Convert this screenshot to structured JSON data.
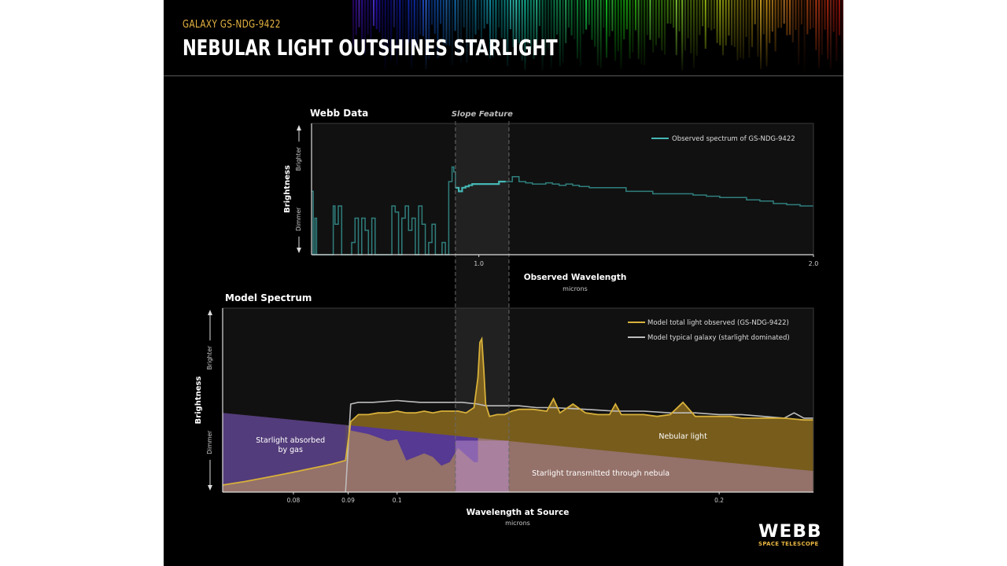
{
  "header": {
    "subtitle": "GALAXY GS-NDG-9422",
    "title": "NEBULAR LIGHT OUTSHINES STARLIGHT"
  },
  "logo": {
    "main": "WEBB",
    "sub": "SPACE TELESCOPE"
  },
  "colors": {
    "observed": "#45b7b4",
    "model_total": "#d8b13a",
    "typical_galaxy": "#bdbdbd",
    "nebular_fill": "#8a6a1e",
    "absorbed_fill": "#4a2f9a",
    "transmitted_fill": "#b98bc8",
    "panel_bg": "#111111"
  },
  "chart_data": [
    {
      "type": "line",
      "title": "Webb Data",
      "highlight_label": "Slope Feature",
      "xlabel": "Observed Wavelength",
      "xunit": "microns",
      "ylabel": "Brightness",
      "y_up_label": "Brighter",
      "y_down_label": "Dimmer",
      "xlim": [
        0.5,
        2.0
      ],
      "xticks": [
        {
          "value": 1.0,
          "label": "1.0"
        },
        {
          "value": 2.0,
          "label": "2.0"
        }
      ],
      "slope_feature_x": [
        0.93,
        1.09
      ],
      "legend_position": "top-right",
      "series": [
        {
          "name": "Observed spectrum of GS-NDG-9422",
          "step": true,
          "x": [
            0.5,
            0.505,
            0.51,
            0.515,
            0.52,
            0.53,
            0.54,
            0.55,
            0.56,
            0.565,
            0.57,
            0.58,
            0.59,
            0.6,
            0.61,
            0.62,
            0.63,
            0.64,
            0.65,
            0.66,
            0.67,
            0.68,
            0.69,
            0.7,
            0.71,
            0.72,
            0.73,
            0.74,
            0.75,
            0.76,
            0.77,
            0.78,
            0.79,
            0.8,
            0.81,
            0.82,
            0.83,
            0.84,
            0.85,
            0.86,
            0.87,
            0.88,
            0.89,
            0.9,
            0.91,
            0.92,
            0.925,
            0.93,
            0.94,
            0.95,
            0.96,
            0.97,
            0.98,
            0.99,
            1.0,
            1.02,
            1.04,
            1.06,
            1.08,
            1.1,
            1.12,
            1.14,
            1.16,
            1.18,
            1.2,
            1.22,
            1.24,
            1.26,
            1.28,
            1.3,
            1.33,
            1.36,
            1.4,
            1.44,
            1.48,
            1.52,
            1.56,
            1.6,
            1.64,
            1.68,
            1.72,
            1.76,
            1.8,
            1.84,
            1.88,
            1.92,
            1.96,
            2.0
          ],
          "y": [
            0.52,
            0.0,
            0.3,
            0.0,
            0.0,
            0.0,
            0.0,
            0.0,
            0.0,
            0.4,
            0.25,
            0.4,
            0.0,
            0.0,
            0.0,
            0.1,
            0.3,
            0.0,
            0.3,
            0.2,
            0.0,
            0.3,
            0.0,
            0.0,
            0.0,
            0.0,
            0.0,
            0.4,
            0.35,
            0.0,
            0.3,
            0.4,
            0.2,
            0.3,
            0.0,
            0.4,
            0.25,
            0.0,
            0.1,
            0.25,
            0.0,
            0.0,
            0.1,
            0.0,
            0.6,
            0.72,
            0.68,
            0.55,
            0.52,
            0.55,
            0.56,
            0.57,
            0.58,
            0.58,
            0.58,
            0.58,
            0.58,
            0.6,
            0.6,
            0.64,
            0.6,
            0.59,
            0.58,
            0.58,
            0.59,
            0.58,
            0.57,
            0.58,
            0.57,
            0.56,
            0.55,
            0.55,
            0.55,
            0.52,
            0.52,
            0.5,
            0.5,
            0.5,
            0.49,
            0.48,
            0.47,
            0.47,
            0.45,
            0.44,
            0.42,
            0.41,
            0.4,
            0.4
          ]
        }
      ]
    },
    {
      "type": "area",
      "title": "Model Spectrum",
      "xlabel": "Wavelength at Source",
      "xunit": "microns",
      "ylabel": "Brightness",
      "y_up_label": "Brighter",
      "y_down_label": "Dimmer",
      "xlim": [
        0.0687,
        0.245
      ],
      "xscale": "log",
      "xticks": [
        {
          "value": 0.08,
          "label": "0.08"
        },
        {
          "value": 0.09,
          "label": "0.09"
        },
        {
          "value": 0.1,
          "label": "0.1"
        },
        {
          "value": 0.2,
          "label": "0.2"
        }
      ],
      "legend_position": "top-right",
      "region_labels": [
        {
          "text": [
            "Starlight absorbed",
            "by gas"
          ],
          "x": 0.0795
        },
        {
          "text": [
            "Nebular light"
          ],
          "x": 0.185
        },
        {
          "text": [
            "Starlight transmitted through nebula"
          ],
          "x": 0.155
        }
      ],
      "series": [
        {
          "name": "Model total light observed (GS-NDG-9422)",
          "x": [
            0.0687,
            0.072,
            0.075,
            0.078,
            0.081,
            0.084,
            0.087,
            0.0895,
            0.0905,
            0.092,
            0.094,
            0.096,
            0.098,
            0.1,
            0.102,
            0.104,
            0.106,
            0.108,
            0.11,
            0.112,
            0.114,
            0.116,
            0.118,
            0.119,
            0.1195,
            0.12,
            0.1205,
            0.121,
            0.122,
            0.124,
            0.126,
            0.128,
            0.13,
            0.134,
            0.138,
            0.14,
            0.142,
            0.146,
            0.15,
            0.154,
            0.158,
            0.16,
            0.162,
            0.17,
            0.175,
            0.18,
            0.185,
            0.19,
            0.195,
            0.2,
            0.205,
            0.21,
            0.22,
            0.23,
            0.24,
            0.245
          ],
          "y": [
            0.04,
            0.06,
            0.08,
            0.1,
            0.12,
            0.14,
            0.16,
            0.18,
            0.4,
            0.44,
            0.44,
            0.45,
            0.45,
            0.46,
            0.45,
            0.45,
            0.46,
            0.45,
            0.46,
            0.46,
            0.46,
            0.45,
            0.48,
            0.65,
            0.85,
            0.87,
            0.7,
            0.5,
            0.43,
            0.44,
            0.44,
            0.46,
            0.47,
            0.47,
            0.46,
            0.53,
            0.45,
            0.5,
            0.45,
            0.44,
            0.44,
            0.5,
            0.44,
            0.44,
            0.43,
            0.44,
            0.51,
            0.43,
            0.43,
            0.43,
            0.43,
            0.42,
            0.42,
            0.42,
            0.41,
            0.41
          ]
        },
        {
          "name": "Model typical galaxy (starlight dominated)",
          "x": [
            0.0895,
            0.0905,
            0.092,
            0.095,
            0.1,
            0.105,
            0.11,
            0.115,
            0.119,
            0.121,
            0.125,
            0.13,
            0.135,
            0.14,
            0.15,
            0.16,
            0.17,
            0.18,
            0.19,
            0.2,
            0.21,
            0.22,
            0.23,
            0.235,
            0.24,
            0.245
          ],
          "y": [
            0.0,
            0.5,
            0.51,
            0.51,
            0.52,
            0.51,
            0.51,
            0.51,
            0.5,
            0.49,
            0.49,
            0.49,
            0.48,
            0.48,
            0.47,
            0.46,
            0.46,
            0.45,
            0.45,
            0.44,
            0.44,
            0.43,
            0.42,
            0.45,
            0.42,
            0.42
          ]
        }
      ],
      "fills": {
        "absorbed_top": {
          "x": [
            0.0905,
            0.094,
            0.098,
            0.1,
            0.102,
            0.104,
            0.106,
            0.108,
            0.11,
            0.112,
            0.114,
            0.116,
            0.118,
            0.119
          ],
          "y": [
            0.35,
            0.33,
            0.29,
            0.3,
            0.18,
            0.2,
            0.22,
            0.2,
            0.15,
            0.17,
            0.25,
            0.21,
            0.17,
            0.17
          ]
        },
        "stellar_continuum": {
          "x": [
            0.0687,
            0.245
          ],
          "y": [
            0.45,
            0.12
          ]
        }
      }
    }
  ]
}
